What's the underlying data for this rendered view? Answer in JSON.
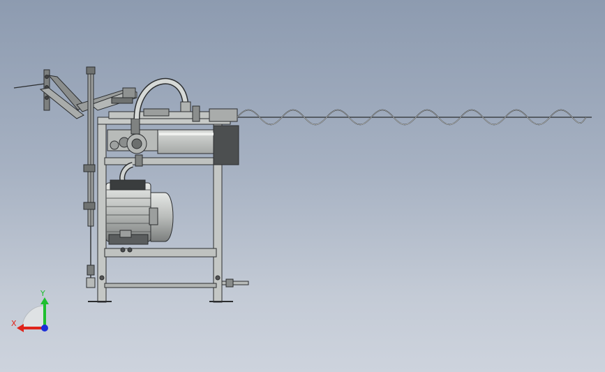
{
  "triad": {
    "y_label": "Y",
    "x_label": "X",
    "y_color": "#1fbf2f",
    "x_color": "#e0241b",
    "z_color": "#1c2fd8"
  },
  "colors": {
    "background_top": "#8d9bb0",
    "background_bottom": "#cdd3dd",
    "part_fill": "#c9ccc9",
    "part_dark": "#5c5f5f",
    "edge": "#2b2d2f"
  }
}
